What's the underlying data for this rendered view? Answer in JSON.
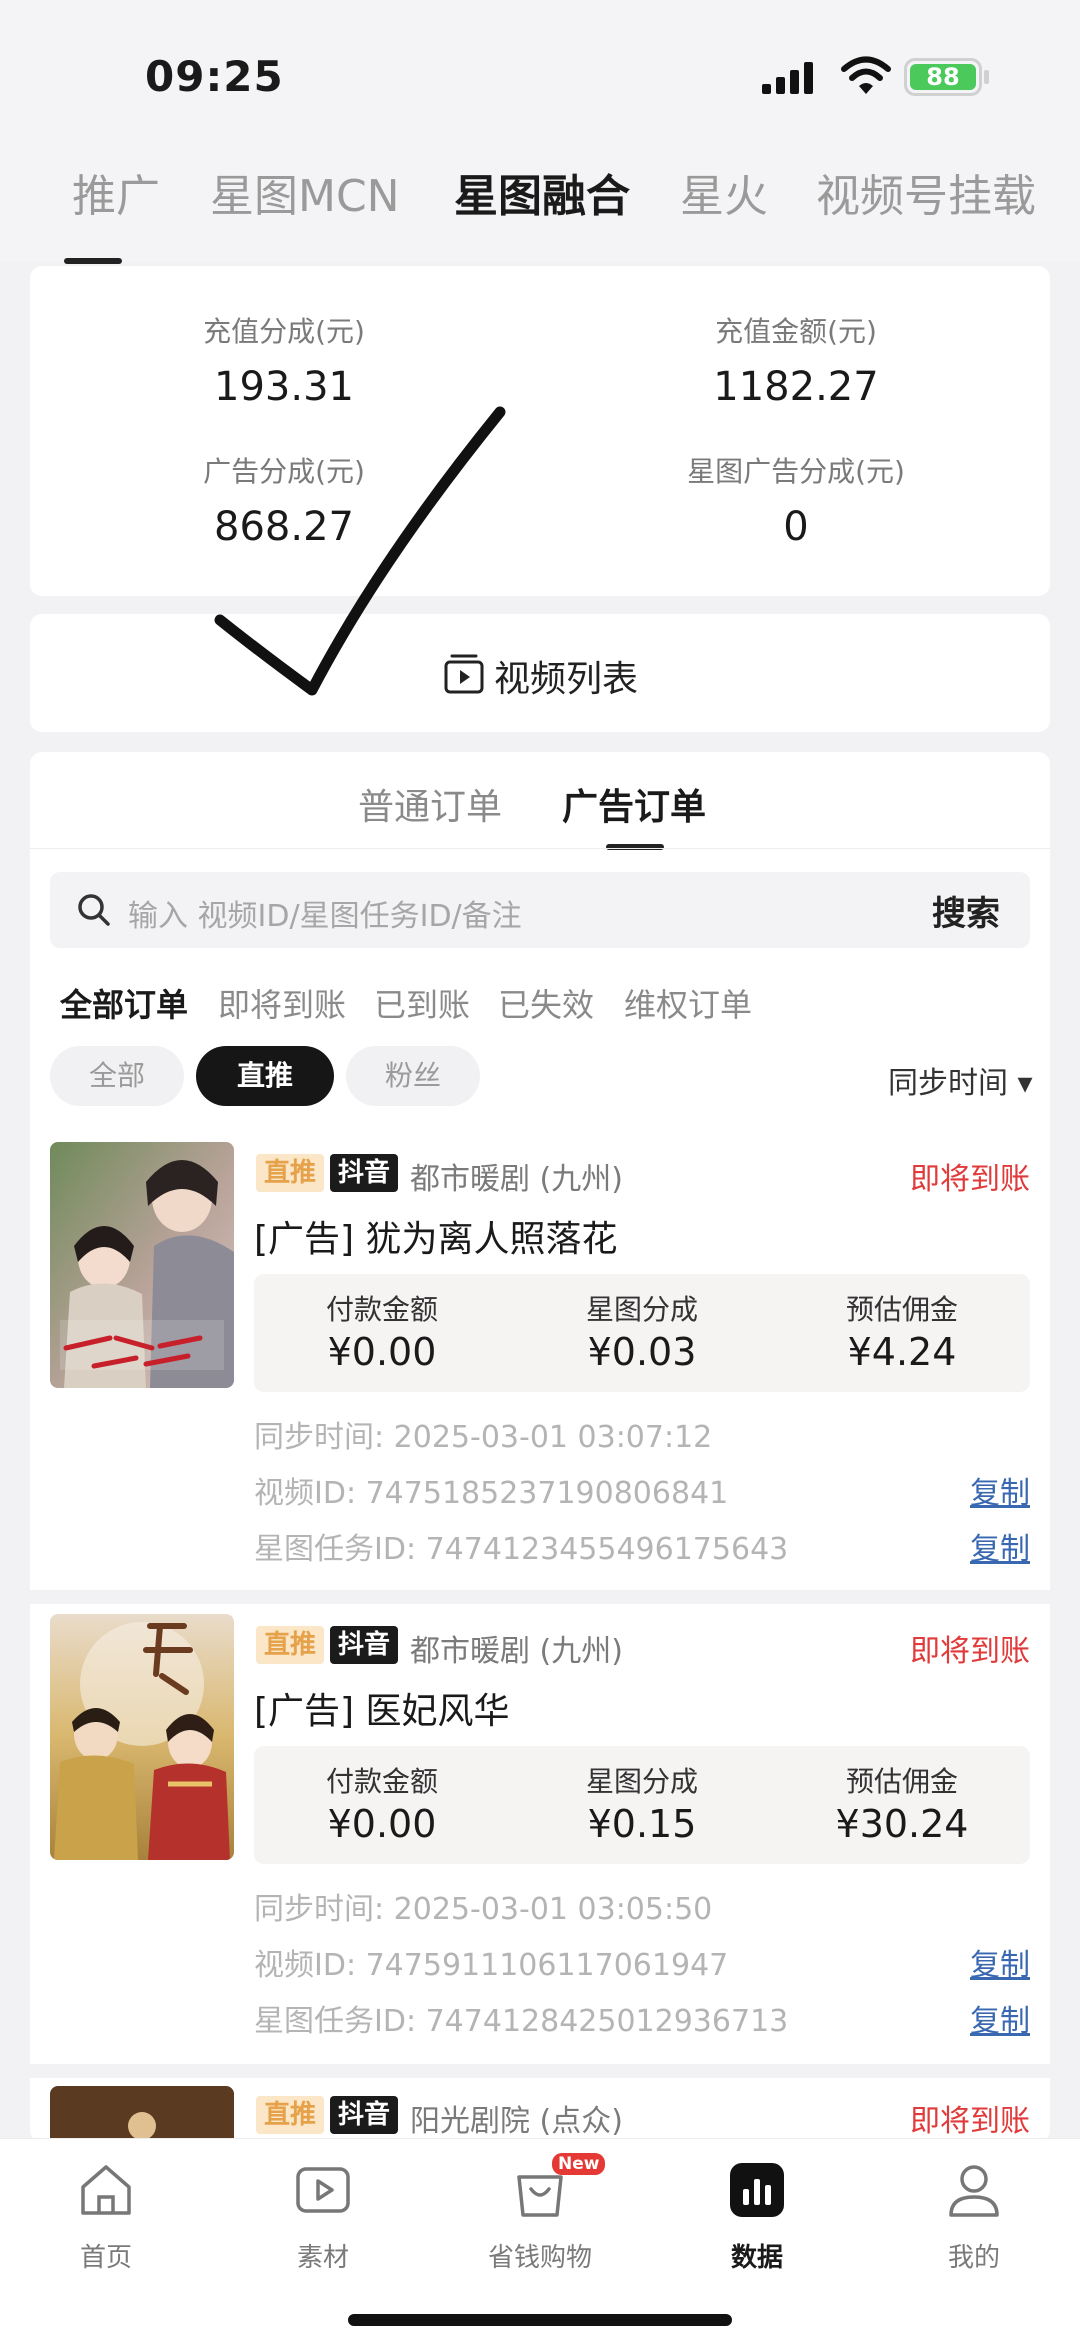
{
  "status": {
    "time": "09:25",
    "battery": "88"
  },
  "top_tabs": [
    {
      "label": "推广"
    },
    {
      "label": "星图MCN"
    },
    {
      "label": "星图融合"
    },
    {
      "label": "星火"
    },
    {
      "label": "视频号挂载"
    }
  ],
  "summary": {
    "items": [
      {
        "label": "充值分成(元)",
        "value": "193.31"
      },
      {
        "label": "充值金额(元)",
        "value": "1182.27"
      },
      {
        "label": "广告分成(元)",
        "value": "868.27"
      },
      {
        "label": "星图广告分成(元)",
        "value": "0"
      }
    ]
  },
  "video_list": {
    "label": "视频列表"
  },
  "order_tabs": [
    {
      "label": "普通订单"
    },
    {
      "label": "广告订单"
    }
  ],
  "search": {
    "placeholder": "输入 视频ID/星图任务ID/备注",
    "button": "搜索"
  },
  "filter_tabs": [
    {
      "label": "全部订单"
    },
    {
      "label": "即将到账"
    },
    {
      "label": "已到账"
    },
    {
      "label": "已失效"
    },
    {
      "label": "维权订单"
    }
  ],
  "chips": [
    {
      "label": "全部"
    },
    {
      "label": "直推"
    },
    {
      "label": "粉丝"
    }
  ],
  "sort": {
    "label": "同步时间 ▾"
  },
  "orders": [
    {
      "tag_type": "直推",
      "platform": "抖音",
      "category": "都市暖剧 (九州)",
      "status": "即将到账",
      "title": "[广告] 犹为离人照落花",
      "stats": [
        {
          "label": "付款金额",
          "value": "¥0.00"
        },
        {
          "label": "星图分成",
          "value": "¥0.03"
        },
        {
          "label": "预估佣金",
          "value": "¥4.24"
        }
      ],
      "sync_time": "同步时间: 2025-03-01 03:07:12",
      "video_id": "视频ID: 7475185237190806841",
      "task_id": "星图任务ID: 7474123455496175643",
      "copy": "复制"
    },
    {
      "tag_type": "直推",
      "platform": "抖音",
      "category": "都市暖剧 (九州)",
      "status": "即将到账",
      "title": "[广告] 医妃风华",
      "stats": [
        {
          "label": "付款金额",
          "value": "¥0.00"
        },
        {
          "label": "星图分成",
          "value": "¥0.15"
        },
        {
          "label": "预估佣金",
          "value": "¥30.24"
        }
      ],
      "sync_time": "同步时间: 2025-03-01 03:05:50",
      "video_id": "视频ID: 7475911106117061947",
      "task_id": "星图任务ID: 7474128425012936713",
      "copy": "复制"
    },
    {
      "tag_type": "直推",
      "platform": "抖音",
      "category": "阳光剧院 (点众)",
      "status": "即将到账"
    }
  ],
  "bottom_nav": [
    {
      "label": "首页",
      "icon": "home-icon"
    },
    {
      "label": "素材",
      "icon": "play-icon"
    },
    {
      "label": "省钱购物",
      "icon": "shopping-bag-icon",
      "badge": "New"
    },
    {
      "label": "数据",
      "icon": "chart-icon"
    },
    {
      "label": "我的",
      "icon": "profile-icon"
    }
  ]
}
